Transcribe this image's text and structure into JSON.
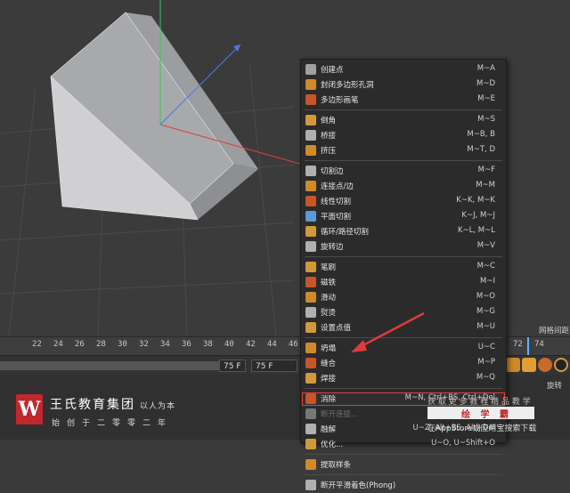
{
  "menu": {
    "groups": [
      [
        {
          "label": "创建点",
          "shortcut": "M~A",
          "icon_color": "#a0a0a0"
        },
        {
          "label": "封闭多边形孔洞",
          "shortcut": "M~D",
          "icon_color": "#d08a2a"
        },
        {
          "label": "多边形画笔",
          "shortcut": "M~E",
          "icon_color": "#c8542a"
        }
      ],
      [
        {
          "label": "倒角",
          "shortcut": "M~S",
          "icon_color": "#d09a3a"
        },
        {
          "label": "桥接",
          "shortcut": "M~B, B",
          "icon_color": "#b0b0b0"
        },
        {
          "label": "挤压",
          "shortcut": "M~T, D",
          "icon_color": "#d08a2a"
        }
      ],
      [
        {
          "label": "切割边",
          "shortcut": "M~F",
          "icon_color": "#b0b0b0"
        },
        {
          "label": "连接点/边",
          "shortcut": "M~M",
          "icon_color": "#d08a2a"
        },
        {
          "label": "线性切割",
          "shortcut": "K~K, M~K",
          "icon_color": "#c8542a"
        },
        {
          "label": "平面切割",
          "shortcut": "K~J, M~J",
          "icon_color": "#5a9ad8"
        },
        {
          "label": "循环/路径切割",
          "shortcut": "K~L, M~L",
          "icon_color": "#d09a3a"
        },
        {
          "label": "旋转边",
          "shortcut": "M~V",
          "icon_color": "#b0b0b0"
        }
      ],
      [
        {
          "label": "笔刷",
          "shortcut": "M~C",
          "icon_color": "#d09a3a"
        },
        {
          "label": "磁铁",
          "shortcut": "M~I",
          "icon_color": "#c8542a"
        },
        {
          "label": "滑动",
          "shortcut": "M~O",
          "icon_color": "#d08a2a"
        },
        {
          "label": "熨烫",
          "shortcut": "M~G",
          "icon_color": "#b0b0b0"
        },
        {
          "label": "设置点值",
          "shortcut": "M~U",
          "icon_color": "#d09a3a"
        }
      ],
      [
        {
          "label": "坍塌",
          "shortcut": "U~C",
          "icon_color": "#d08a2a"
        },
        {
          "label": "缝合",
          "shortcut": "M~P",
          "icon_color": "#c8542a"
        },
        {
          "label": "焊接",
          "shortcut": "M~Q",
          "icon_color": "#d09a3a"
        }
      ],
      [
        {
          "label": "消除",
          "shortcut": "M~N, Ctrl+BS, Ctrl+Del",
          "icon_color": "#c8542a",
          "highlighted": true
        },
        {
          "label": "断开连接...",
          "shortcut": "U~D, U~Shift+D",
          "icon_color": "#777777",
          "disabled": true
        },
        {
          "label": "融解",
          "shortcut": "U~Z, Alt+BS, Alt+Del",
          "icon_color": "#b0b0b0"
        },
        {
          "label": "优化...",
          "shortcut": "U~O, U~Shift+O",
          "icon_color": "#d09a3a"
        }
      ],
      [
        {
          "label": "提取样条",
          "shortcut": "",
          "icon_color": "#d08a2a"
        }
      ],
      [
        {
          "label": "断开平滑着色(Phong)",
          "shortcut": "",
          "icon_color": "#b0b0b0"
        }
      ]
    ]
  },
  "timeline": {
    "ticks": [
      "22",
      "24",
      "26",
      "28",
      "30",
      "32",
      "34",
      "36",
      "38",
      "40",
      "42",
      "44",
      "46",
      "48",
      "50",
      "72",
      "74"
    ]
  },
  "framebar": {
    "frame_a": "75 F",
    "frame_b": "75 F"
  },
  "right_panel": {
    "mesh_label": "网格间距 :",
    "rotate_label": "旋转"
  },
  "brand": {
    "logo_letter": "W",
    "name": "王氏教育集团",
    "tagline": "以人为本",
    "slogan": "始创于二零零二年"
  },
  "watermark": {
    "line1": "获 取 更 多 教 程 精 品 教 学",
    "box_text": "绘 学 霸",
    "line2": "在AppStore或应用宝搜索下载"
  },
  "colors": {
    "highlight": "#e03a3a",
    "x_axis": "#d84040",
    "y_axis": "#40c060",
    "z_axis": "#4a7ad8"
  }
}
